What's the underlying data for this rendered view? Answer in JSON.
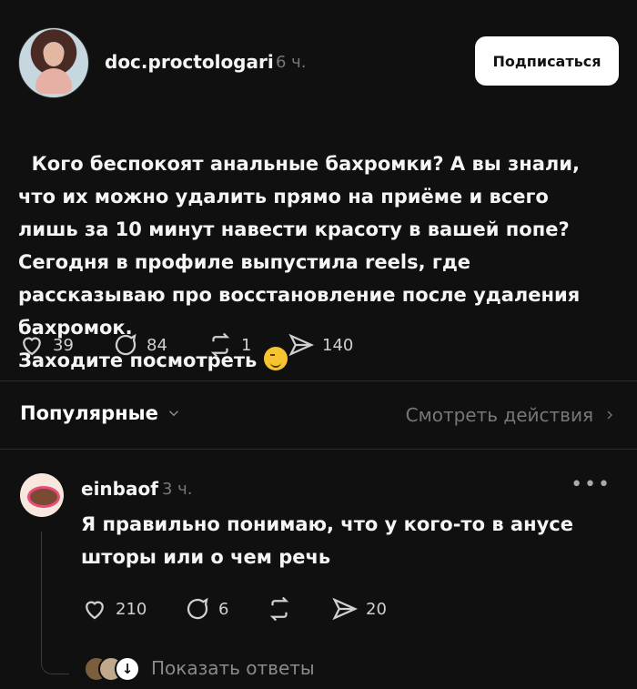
{
  "post": {
    "username": "doc.proctologari",
    "time": "6 ч.",
    "follow_label": "Подписаться",
    "text_main": "Кого беспокоят анальные бахромки? А вы знали, что их можно удалить прямо на приёме и всего лишь за 10 минут навести красоту в вашей попе?\nСегодня в профиле выпустила reels, где рассказываю про восстановление после удаления бахромок.\nЗаходите посмотреть ",
    "emoji": "winking-face",
    "actions": {
      "likes": "39",
      "comments": "84",
      "reposts": "1",
      "shares": "140"
    }
  },
  "section": {
    "sort_label": "Популярные",
    "view_actions_label": "Смотреть действия"
  },
  "reply": {
    "username": "einbaof",
    "time": "3 ч.",
    "text": "Я правильно понимаю, что у кого-то в анусе шторы или о чем речь",
    "actions": {
      "likes": "210",
      "comments": "6",
      "reposts": "",
      "shares": "20"
    },
    "show_replies_label": "Показать ответы"
  },
  "colors": {
    "background": "#101010",
    "text": "#f3f5f7",
    "muted": "#777777",
    "button_bg": "#ffffff"
  }
}
